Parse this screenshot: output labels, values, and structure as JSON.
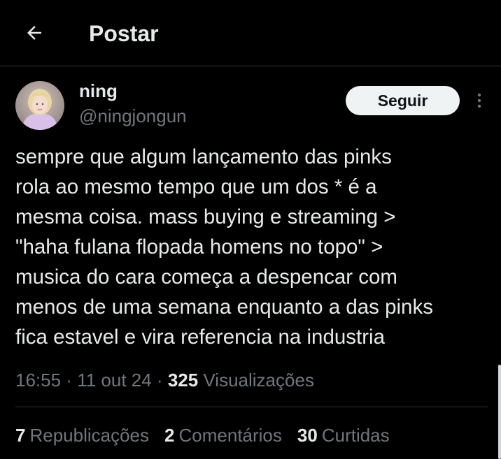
{
  "header": {
    "title": "Postar",
    "back_icon": "arrow-left-icon"
  },
  "author": {
    "display_name": "ning",
    "handle": "@ningjongun",
    "avatar_icon": "user-avatar"
  },
  "actions": {
    "follow_label": "Seguir",
    "more_icon": "more-vertical-icon"
  },
  "tweet": {
    "text": "sempre que algum lançamento das pinks\nrola ao mesmo tempo que um dos * é a\nmesma coisa. mass buying e streaming >\n\"haha fulana flopada homens no topo\" >\nmusica do cara começa a despencar com\nmenos de uma semana enquanto a das pinks\nfica estavel e vira referencia na industria"
  },
  "meta": {
    "time": "16:55",
    "sep1": " · ",
    "date": "11 out 24",
    "sep2": " · ",
    "views_count": "325",
    "views_label": "Visualizações"
  },
  "stats": {
    "reposts_count": "7",
    "reposts_label": "Republicações",
    "comments_count": "2",
    "comments_label": "Comentários",
    "likes_count": "30",
    "likes_label": "Curtidas"
  },
  "colors": {
    "background": "#000000",
    "text_primary": "#e7e9ea",
    "text_secondary": "#71767b",
    "border": "#2f3336",
    "follow_button_bg": "#eff3f4",
    "follow_button_text": "#0f1419"
  }
}
